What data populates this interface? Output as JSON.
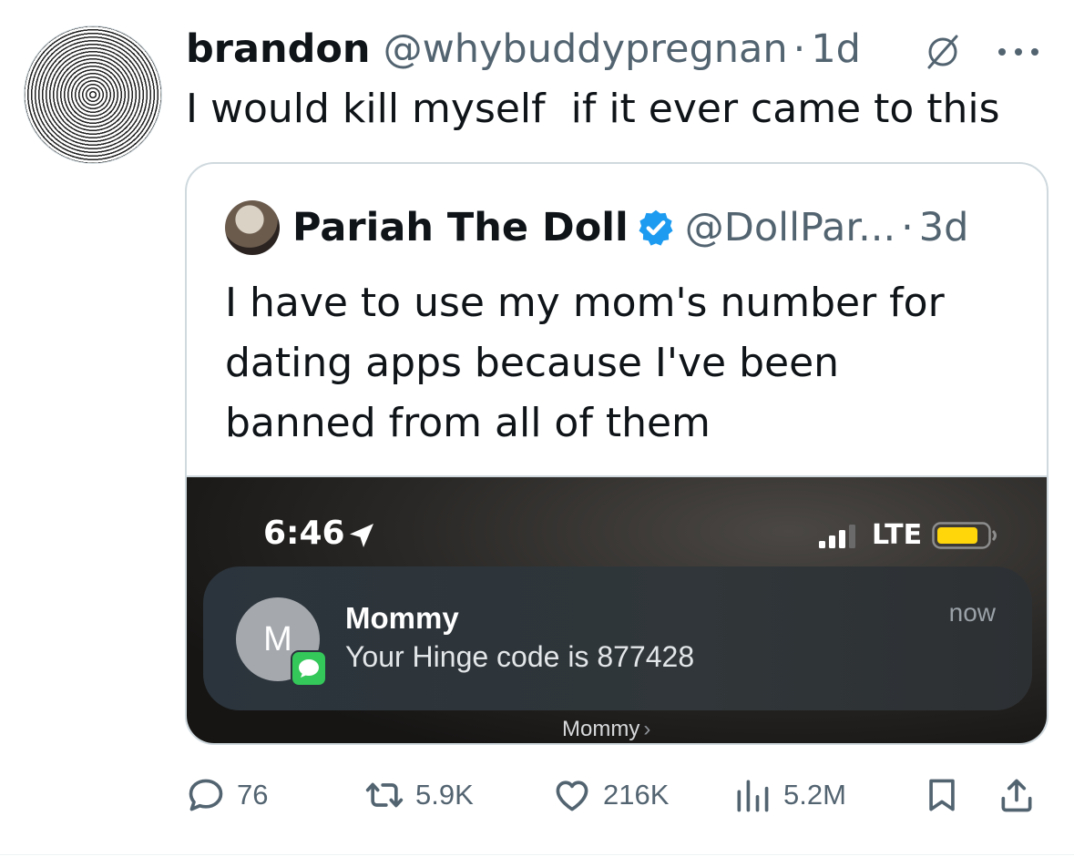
{
  "tweet": {
    "author_name": "brandon",
    "handle": "@whybuddypregnan",
    "separator": "·",
    "time": "1d",
    "text": "I would kill myself  if it ever came to this",
    "avatar_icon": "concentric-circles-avatar",
    "grok_icon": "slashed-circle-icon",
    "more_icon": "more-dots-icon"
  },
  "quoted": {
    "author_name": "Pariah The Doll",
    "verified": true,
    "verified_color": "#1d9bf0",
    "handle": "@DollPar...",
    "separator": "·",
    "time": "3d",
    "text_lines": [
      "I have to use my mom's number for",
      "dating apps because I've been",
      "banned from all of them"
    ]
  },
  "screenshot": {
    "status_time": "6:46",
    "network": "LTE",
    "battery_color": "#ffd60a",
    "notification": {
      "avatar_letter": "M",
      "sender": "Mommy",
      "body": "Your Hinge code is 877428",
      "time": "now",
      "badge_color": "#34c759"
    },
    "stack_label": "Mommy",
    "stack_chevron": "›"
  },
  "actions": {
    "replies": "76",
    "reposts": "5.9K",
    "likes": "216K",
    "views": "5.2M"
  },
  "colors": {
    "text_primary": "#0f1419",
    "text_secondary": "#536471",
    "border": "#cfd9de"
  }
}
